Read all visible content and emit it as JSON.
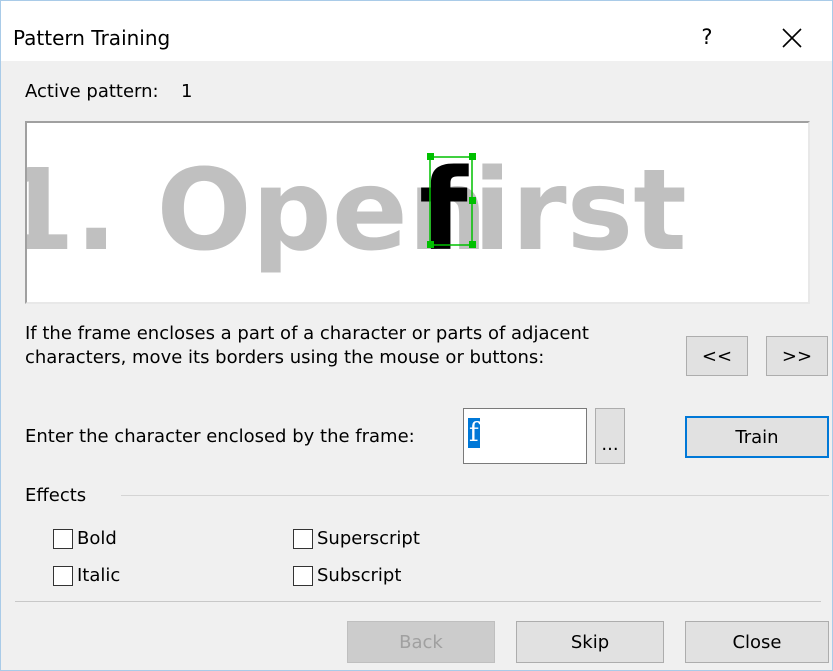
{
  "dialog": {
    "title": "Pattern Training",
    "help_label": "?",
    "close_icon": "close-icon"
  },
  "active_pattern": {
    "label": "Active pattern:",
    "value": "1"
  },
  "preview": {
    "text_before": "1. Open ",
    "highlighted_char": "f",
    "text_after": "irst",
    "colors": {
      "dim_text": "#c0c0c0",
      "active_char": "#000000",
      "frame": "#00c000"
    }
  },
  "instructions": {
    "line1": "If the frame encloses a part of a character or parts of adjacent",
    "line2": "characters, move its borders using the mouse or buttons:"
  },
  "nav_buttons": {
    "prev_label": "<<",
    "next_label": ">>"
  },
  "entry": {
    "label": "Enter the character enclosed by the frame:",
    "value": "f",
    "browse_label": "...",
    "train_label": "Train"
  },
  "effects": {
    "title": "Effects",
    "options": [
      {
        "label": "Bold",
        "checked": false
      },
      {
        "label": "Italic",
        "checked": false
      },
      {
        "label": "Superscript",
        "checked": false
      },
      {
        "label": "Subscript",
        "checked": false
      }
    ]
  },
  "footer": {
    "back_label": "Back",
    "skip_label": "Skip",
    "close_label": "Close"
  }
}
